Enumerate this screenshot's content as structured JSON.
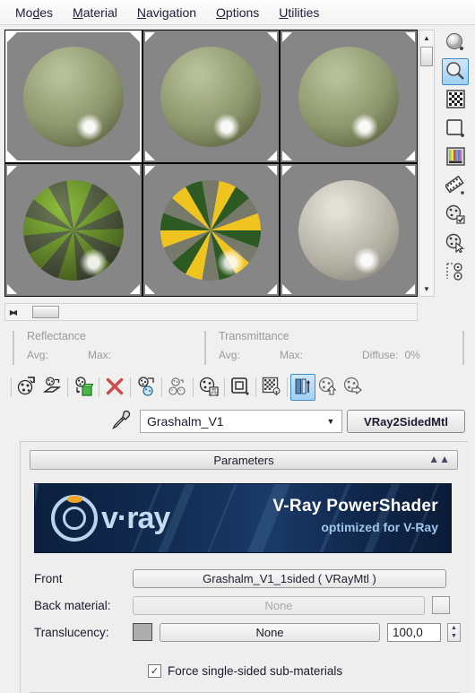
{
  "menubar": {
    "items": [
      {
        "label": "Modes",
        "pre": "Mo",
        "accel": "d",
        "post": "es"
      },
      {
        "label": "Material",
        "pre": "",
        "accel": "M",
        "post": "aterial"
      },
      {
        "label": "Navigation",
        "pre": "",
        "accel": "N",
        "post": "avigation"
      },
      {
        "label": "Options",
        "pre": "",
        "accel": "O",
        "post": "ptions"
      },
      {
        "label": "Utilities",
        "pre": "",
        "accel": "U",
        "post": "tilities"
      }
    ]
  },
  "preview_slots": {
    "selected_index": 0,
    "slots": [
      {
        "name": "slot-1",
        "material": "green-glossy",
        "style": "sph-green",
        "selected": true
      },
      {
        "name": "slot-2",
        "material": "green-glossy",
        "style": "sph-green",
        "selected": false
      },
      {
        "name": "slot-3",
        "material": "green-glossy",
        "style": "sph-green",
        "selected": false
      },
      {
        "name": "slot-4",
        "material": "green-checker",
        "style": "sph-checkA",
        "selected": false
      },
      {
        "name": "slot-5",
        "material": "yellow-checker",
        "style": "sph-checkB",
        "selected": false
      },
      {
        "name": "slot-6",
        "material": "grey-matte",
        "style": "sph-grey",
        "selected": false
      }
    ]
  },
  "scrollbars": {
    "vertical": {
      "up_icon": "triangle-up-icon",
      "down_icon": "triangle-down-icon"
    },
    "horizontal": {
      "left_icon": "triangle-left-icon",
      "right_icon": "triangle-right-icon"
    }
  },
  "vertical_toolbar": {
    "buttons": [
      {
        "name": "sample-type-sphere-button",
        "icon": "sphere-icon",
        "active": false
      },
      {
        "name": "backlight-button",
        "icon": "magnifier-sphere-icon",
        "active": true
      },
      {
        "name": "background-checker-button",
        "icon": "checker-grid-icon",
        "active": false
      },
      {
        "name": "sample-uv-tiling-button",
        "icon": "square-icon",
        "active": false
      },
      {
        "name": "video-color-check-button",
        "icon": "color-bars-icon",
        "active": false
      },
      {
        "name": "make-preview-button",
        "icon": "film-icon",
        "active": false
      },
      {
        "name": "options-button",
        "icon": "sphere-check-icon",
        "active": false
      },
      {
        "name": "select-by-material-button",
        "icon": "sphere-cursor-icon",
        "active": false
      },
      {
        "name": "material-id-channel-button",
        "icon": "id-channel-icon",
        "active": false
      }
    ]
  },
  "reflectance": {
    "left_title": "Reflectance",
    "left_avg": "Avg:",
    "left_max": "Max:",
    "right_title": "Transmittance",
    "right_avg": "Avg:",
    "right_max": "Max:",
    "diffuse_label": "Diffuse:",
    "diffuse_value": "0%"
  },
  "horizontal_toolbar": {
    "buttons": [
      {
        "name": "get-material-button",
        "icon": "sphere-arrow-icon",
        "active": false
      },
      {
        "name": "assign-to-selection-button",
        "icon": "sphere-plane-icon",
        "active": false
      },
      {
        "name": "put-to-scene-button",
        "icon": "sphere-cube-icon",
        "active": false
      },
      {
        "name": "reset-map-button",
        "icon": "red-x-icon",
        "active": false
      },
      {
        "name": "make-unique-button",
        "icon": "sphere-link-icon",
        "active": false
      },
      {
        "name": "put-to-library-button",
        "icon": "sphere-group-icon",
        "active": false
      },
      {
        "name": "save-material-button",
        "icon": "sphere-save-icon",
        "active": false
      },
      {
        "name": "show-map-in-viewport-button",
        "icon": "square-outline-icon",
        "active": false
      },
      {
        "name": "show-end-result-button",
        "icon": "checker-pin-icon",
        "active": false
      },
      {
        "name": "go-to-parent-button",
        "icon": "blue-columns-icon",
        "active": true
      },
      {
        "name": "go-forward-sibling-button",
        "icon": "sphere-up-arrow-icon",
        "active": false
      },
      {
        "name": "pick-material-button",
        "icon": "sphere-right-arrow-icon",
        "active": false
      }
    ]
  },
  "material_row": {
    "eyedropper_icon": "eyedropper-icon",
    "name_value": "Grashalm_V1",
    "name_placeholder": "Material name",
    "dropdown_icon": "chevron-down-icon",
    "type_button_label": "VRay2SidedMtl"
  },
  "rollout": {
    "title": "Parameters",
    "collapse_icon": "chevron-double-up-icon"
  },
  "banner": {
    "logo_text": "v·ray",
    "title": "V-Ray PowerShader",
    "subtitle": "optimized for V-Ray",
    "bg_color": "#112a4f",
    "accent_color": "#9ec6e8"
  },
  "params": {
    "front": {
      "label": "Front",
      "button": "Grashalm_V1_1sided  ( VRayMtl )"
    },
    "back_material": {
      "label": "Back material:",
      "button": "None",
      "checkbox_checked": false
    },
    "translucency": {
      "label": "Translucency:",
      "swatch_color": "#adadad",
      "button": "None",
      "amount": "100,0",
      "spin_up_icon": "spinner-up-icon",
      "spin_down_icon": "spinner-down-icon"
    },
    "force_single_sided": {
      "label": "Force single-sided sub-materials",
      "checked": true,
      "check_glyph": "✓"
    }
  }
}
